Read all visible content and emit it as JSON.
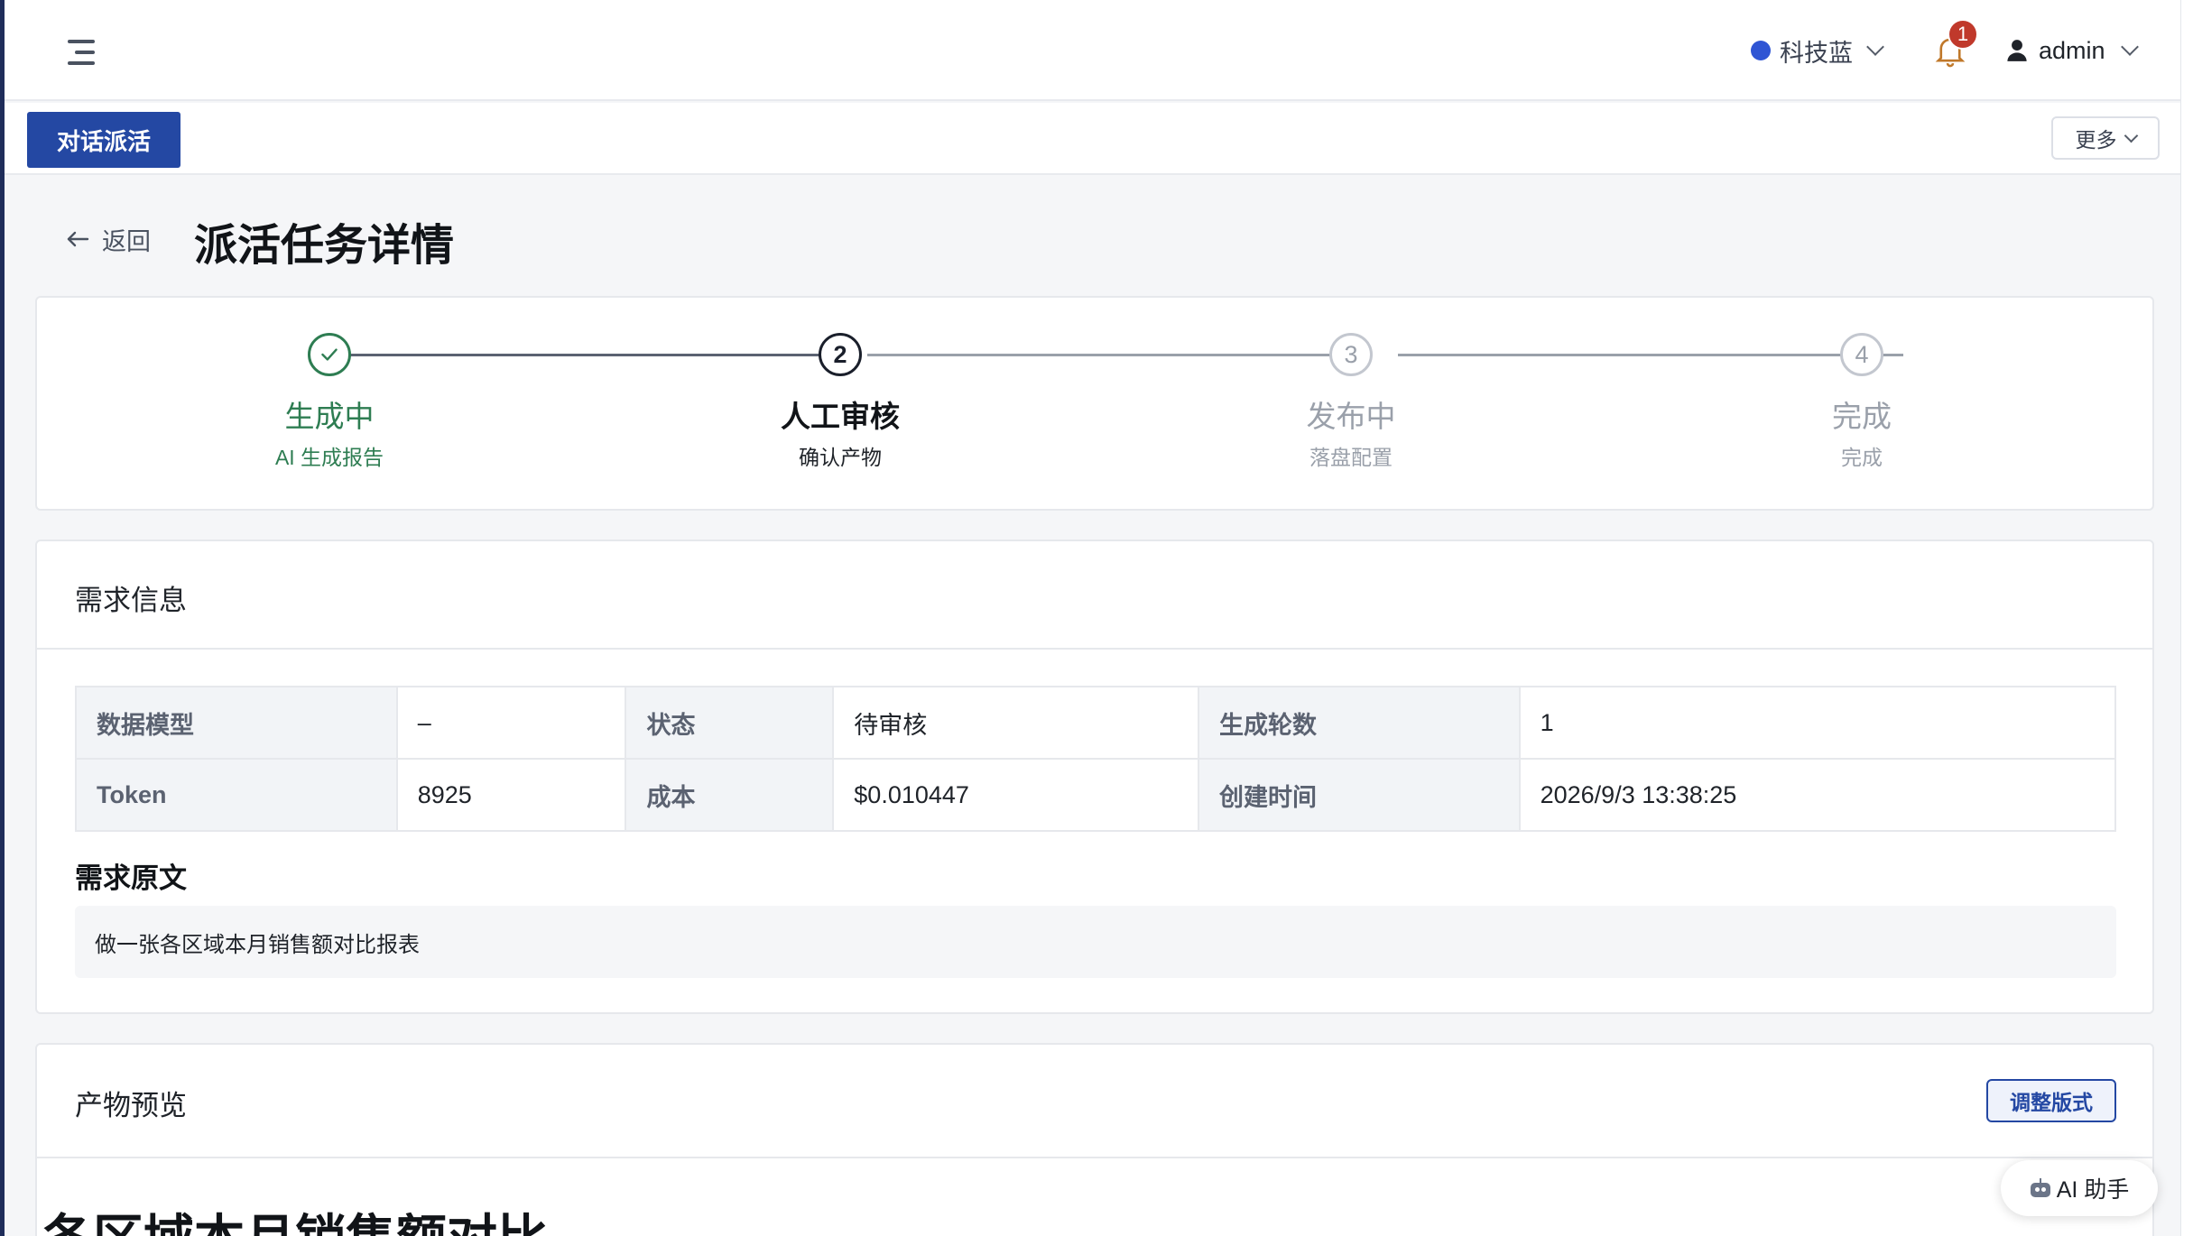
{
  "header": {
    "theme_label": "科技蓝",
    "notification_count": "1",
    "username": "admin",
    "theme_color": "#2f55d4"
  },
  "tags": {
    "active_tab": "对话派活",
    "more_label": "更多"
  },
  "page": {
    "back_label": "返回",
    "title": "派活任务详情"
  },
  "steps": [
    {
      "number": "1",
      "title": "生成中",
      "desc": "AI 生成报告",
      "status": "done"
    },
    {
      "number": "2",
      "title": "人工审核",
      "desc": "确认产物",
      "status": "active"
    },
    {
      "number": "3",
      "title": "发布中",
      "desc": "落盘配置",
      "status": "wait"
    },
    {
      "number": "4",
      "title": "完成",
      "desc": "完成",
      "status": "wait"
    }
  ],
  "requirement": {
    "section_title": "需求信息",
    "rows": [
      [
        {
          "label": "数据模型",
          "value": "–"
        },
        {
          "label": "状态",
          "value": "待审核"
        },
        {
          "label": "生成轮数",
          "value": "1"
        }
      ],
      [
        {
          "label": "Token",
          "value": "8925"
        },
        {
          "label": "成本",
          "value": "$0.010447"
        },
        {
          "label": "创建时间",
          "value": "2026/9/3 13:38:25"
        }
      ]
    ],
    "raw_title": "需求原文",
    "raw_text": "做一张各区域本月销售额对比报表"
  },
  "preview": {
    "section_title": "产物预览",
    "adjust_label": "调整版式",
    "heading": "各区域本月销售额对比"
  },
  "assistant": {
    "label": "AI 助手"
  },
  "colors": {
    "primary": "#2448a3",
    "success": "#2e7d52",
    "badge": "#c0392b"
  }
}
